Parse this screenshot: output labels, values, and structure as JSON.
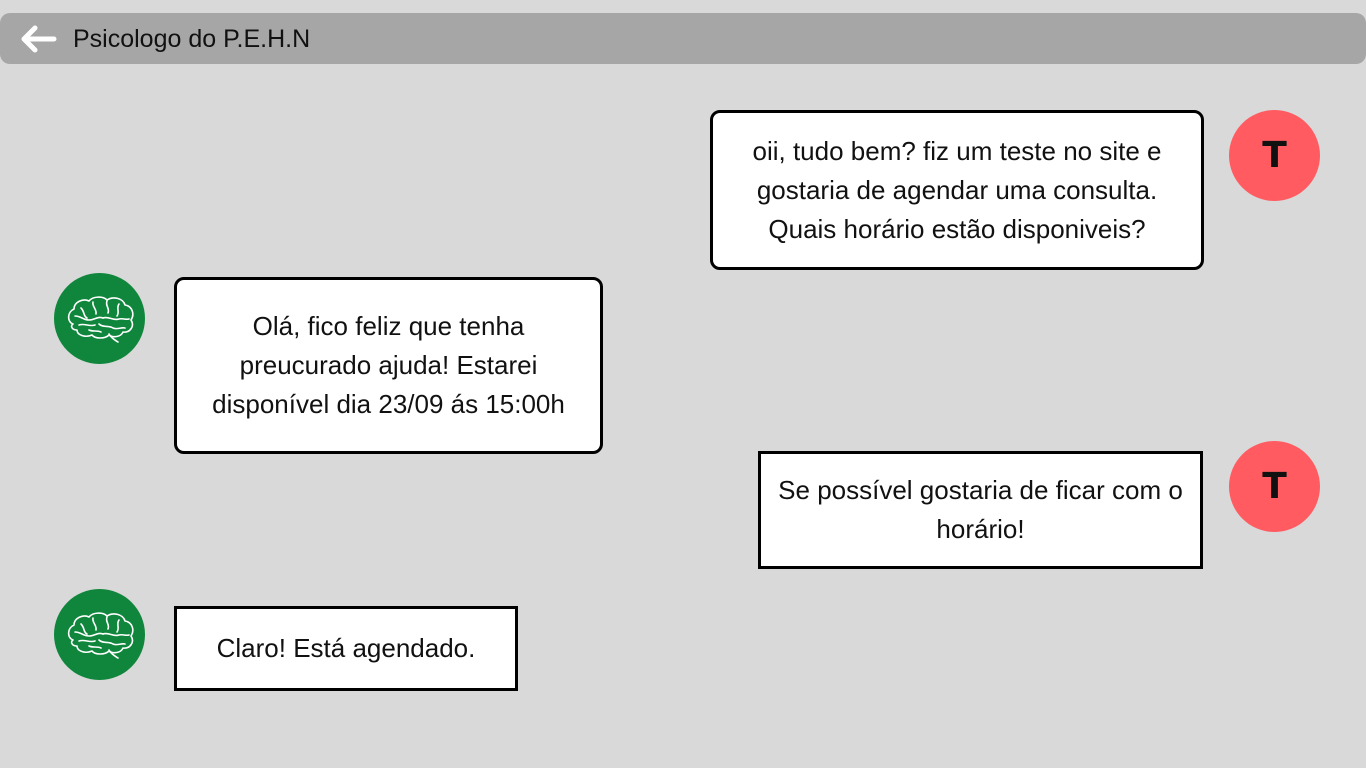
{
  "header": {
    "title": "Psicologo do P.E.H.N",
    "back_icon": "arrow-left-icon"
  },
  "colors": {
    "background": "#d9d9d9",
    "header_bar": "#a6a6a6",
    "user_avatar": "#ff5b61",
    "psychologist_avatar": "#0f863b",
    "bubble_background": "#ffffff",
    "bubble_border": "#000000"
  },
  "messages": [
    {
      "sender": "user",
      "avatar_initial": "T",
      "text": "oii, tudo bem? fiz um teste no site e gostaria de agendar uma consulta. Quais horário estão disponiveis?"
    },
    {
      "sender": "psychologist",
      "avatar_icon": "brain-icon",
      "text": "Olá, fico feliz que tenha preucurado ajuda! Estarei disponível dia 23/09 ás 15:00h"
    },
    {
      "sender": "user",
      "avatar_initial": "T",
      "text": "Se possível gostaria de ficar com o horário!"
    },
    {
      "sender": "psychologist",
      "avatar_icon": "brain-icon",
      "text": "Claro! Está agendado."
    }
  ]
}
